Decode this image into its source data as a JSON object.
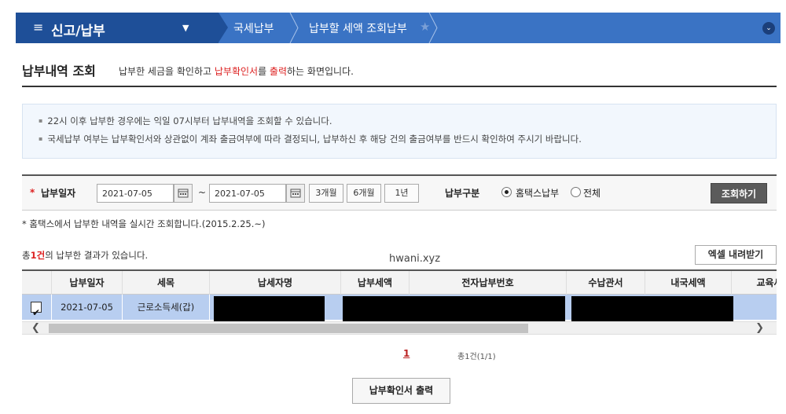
{
  "nav": {
    "menu_title": "신고/납부",
    "crumb1": "국세납부",
    "crumb2": "납부할 세액 조회납부"
  },
  "header": {
    "title": "납부내역 조회",
    "desc_pre": "납부한 세금을 확인하고 ",
    "desc_red1": "납부확인서",
    "desc_mid": "를 ",
    "desc_red2": "출력",
    "desc_post": "하는 화면입니다."
  },
  "notice": {
    "items": [
      "22시 이후 납부한 경우에는 익일 07시부터 납부내역을 조회할 수 있습니다.",
      "국세납부 여부는 납부확인서와 상관없이 계좌 출금여부에 따라 결정되니, 납부하신 후 해당 건의 출금여부를 반드시 확인하여 주시기 바랍니다."
    ]
  },
  "search": {
    "required_mark": "*",
    "date_label": "납부일자",
    "date_from": "2021-07-05",
    "tilde": "~",
    "date_to": "2021-07-05",
    "period_3m": "3개월",
    "period_6m": "6개월",
    "period_1y": "1년",
    "type_label": "납부구분",
    "type_hometax": "홈택스납부",
    "type_all": "전체",
    "submit": "조회하기"
  },
  "note_hometax": "* 홈택스에서 납부한 내역을 실시간 조회합니다.(2015.2.25.~)",
  "results": {
    "count_pre": "총",
    "count_value": "1건",
    "count_post": "의 납부한 결과가 있습니다.",
    "watermark": "hwani.xyz",
    "excel_button": "엑셀 내려받기"
  },
  "table": {
    "headers": [
      "납부일자",
      "세목",
      "납세자명",
      "납부세액",
      "전자납부번호",
      "수납관서",
      "내국세액",
      "교육세"
    ],
    "rows": [
      {
        "date": "2021-07-05",
        "tax_item": "근로소득세(갑)"
      }
    ]
  },
  "pagination": {
    "current": "1",
    "total": "총1건(1/1)"
  },
  "print_button": "납부확인서 출력",
  "colors": {
    "nav_dark": "#1e4f98",
    "nav_light": "#3a73c4",
    "row_selected": "#b8cef0",
    "accent_red": "#d22"
  }
}
